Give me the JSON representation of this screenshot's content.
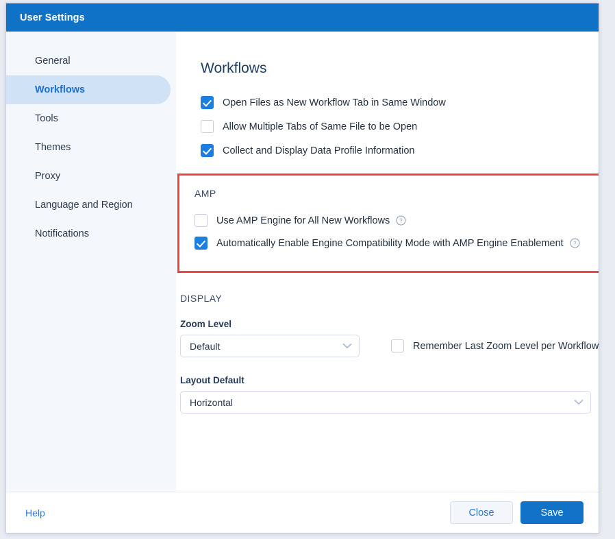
{
  "window": {
    "title": "User Settings"
  },
  "sidebar": {
    "items": [
      {
        "label": "General",
        "active": false
      },
      {
        "label": "Workflows",
        "active": true
      },
      {
        "label": "Tools",
        "active": false
      },
      {
        "label": "Themes",
        "active": false
      },
      {
        "label": "Proxy",
        "active": false
      },
      {
        "label": "Language and Region",
        "active": false
      },
      {
        "label": "Notifications",
        "active": false
      }
    ]
  },
  "content": {
    "page_title": "Workflows",
    "top_options": [
      {
        "label": "Open Files as New Workflow Tab in Same Window",
        "checked": true,
        "help": false
      },
      {
        "label": "Allow Multiple Tabs of Same File to be Open",
        "checked": false,
        "help": false
      },
      {
        "label": "Collect and Display Data Profile Information",
        "checked": true,
        "help": false
      }
    ],
    "amp": {
      "heading": "AMP",
      "highlighted": true,
      "highlight_color": "#f0443e",
      "options": [
        {
          "label": "Use AMP Engine for All New Workflows",
          "checked": false,
          "help": true
        },
        {
          "label": "Automatically Enable Engine Compatibility Mode with AMP Engine Enablement",
          "checked": true,
          "help": true
        }
      ]
    },
    "display": {
      "heading": "DISPLAY",
      "zoom_level": {
        "label": "Zoom Level",
        "value": "Default"
      },
      "remember_zoom": {
        "label": "Remember Last Zoom Level per Workflow",
        "checked": false
      },
      "layout_default": {
        "label": "Layout Default",
        "value": "Horizontal"
      }
    }
  },
  "footer": {
    "help_label": "Help",
    "close_label": "Close",
    "save_label": "Save"
  },
  "colors": {
    "titlebar": "#1072c6",
    "accent": "#1272c8",
    "sidebar_bg": "#f4f7fc",
    "sidebar_active": "#cfe2f6",
    "checkbox_on": "#1c7fe0",
    "highlight": "#f0443e"
  }
}
